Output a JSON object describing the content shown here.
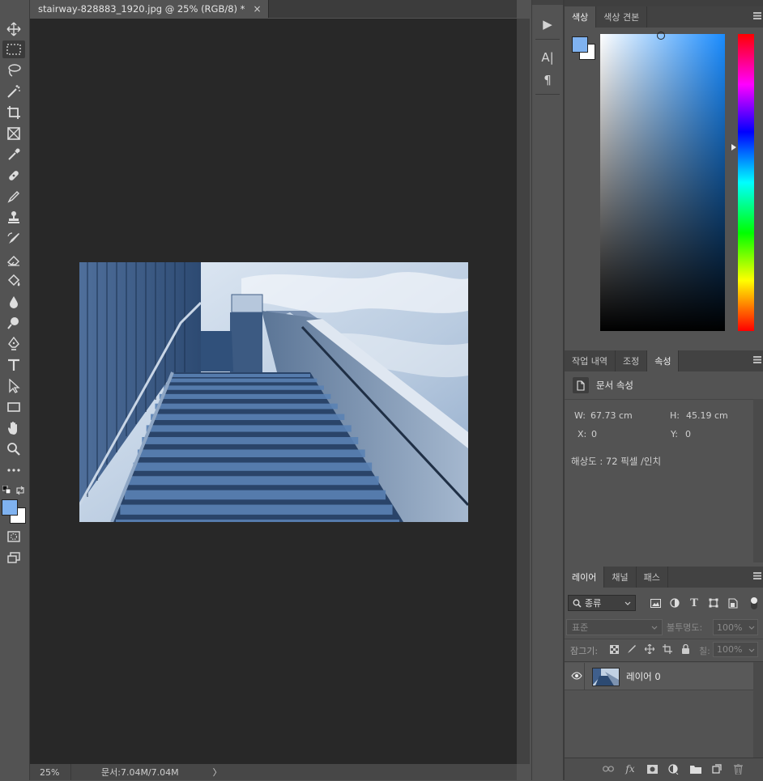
{
  "document": {
    "tab_title": "stairway-828883_1920.jpg @ 25% (RGB/8) *",
    "close_glyph": "×"
  },
  "status_bar": {
    "zoom": "25%",
    "doc_size": "문서:7.04M/7.04M",
    "arrow": "〉"
  },
  "toolbar": {
    "foreground_color": "#7fb2f0",
    "background_color": "#ffffff"
  },
  "mini_dock": {
    "play_glyph": "▶",
    "character_glyph": "A|",
    "paragraph_glyph": "¶"
  },
  "color_panel": {
    "tabs": [
      "색상",
      "색상 견본"
    ],
    "active_tab": "색상",
    "current_hue": "#1a8cff"
  },
  "properties_panel": {
    "tabs": [
      "작업 내역",
      "조정",
      "속성"
    ],
    "active_tab": "속성",
    "section_title": "문서 속성",
    "w_label": "W:",
    "w_value": "67.73 cm",
    "h_label": "H:",
    "h_value": "45.19 cm",
    "x_label": "X:",
    "x_value": "0",
    "y_label": "Y:",
    "y_value": "0",
    "resolution": "해상도 : 72 픽셀 /인치"
  },
  "layers_panel": {
    "tabs": [
      "레이어",
      "채널",
      "패스"
    ],
    "active_tab": "레이어",
    "filter_kind": "종류",
    "blend_mode": "표준",
    "opacity_label": "불투명도:",
    "opacity_value": "100%",
    "lock_label": "잠그기:",
    "fill_label": "칠:",
    "fill_value": "100%",
    "layers": [
      {
        "name": "레이어 0",
        "visible": true
      }
    ],
    "footer_fx": "fx"
  }
}
